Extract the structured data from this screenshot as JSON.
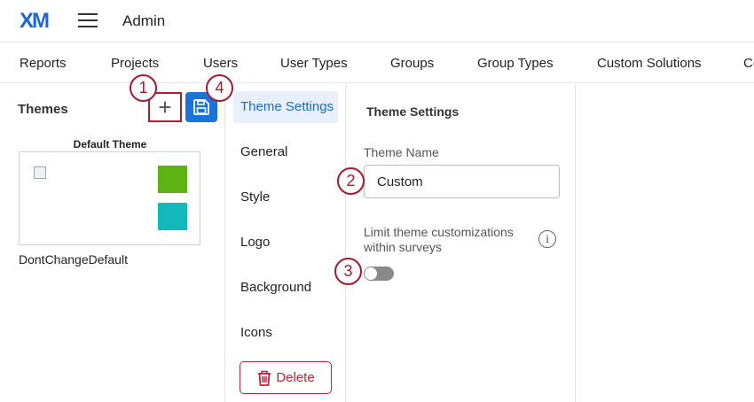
{
  "header": {
    "logo": "XM",
    "title": "Admin"
  },
  "nav": {
    "items": [
      "Reports",
      "Projects",
      "Users",
      "User Types",
      "Groups",
      "Group Types",
      "Custom Solutions",
      "Co"
    ]
  },
  "themes_panel": {
    "title": "Themes",
    "add_label": "+",
    "default_theme_label": "Default Theme",
    "theme_name": "DontChangeDefault",
    "swatch_colors": [
      "#5db312",
      "#13b8bd"
    ]
  },
  "settings_menu": {
    "active": "Theme Settings",
    "items": [
      "General",
      "Style",
      "Logo",
      "Background",
      "Icons"
    ],
    "delete_label": "Delete"
  },
  "theme_settings": {
    "title": "Theme Settings",
    "name_label": "Theme Name",
    "name_value": "Custom",
    "limit_label": "Limit theme customizations within surveys",
    "info_glyph": "i",
    "toggle_on": false
  },
  "callouts": [
    "1",
    "2",
    "3",
    "4"
  ],
  "colors": {
    "accent": "#1a68d8",
    "danger": "#c4223a",
    "callout": "#a7192b"
  }
}
